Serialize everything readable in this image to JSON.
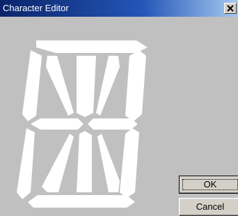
{
  "window": {
    "title": "Character Editor",
    "close_label": "close"
  },
  "display": {
    "segments": [
      "top",
      "upper-left",
      "upper-diagonal-left",
      "upper-center",
      "upper-diagonal-right",
      "upper-right",
      "middle-left",
      "middle-right",
      "lower-left",
      "lower-diagonal-left",
      "lower-center",
      "lower-diagonal-right",
      "lower-right",
      "bottom"
    ],
    "segment_color": "#ffffff"
  },
  "buttons": {
    "ok_label": "OK",
    "cancel_label": "Cancel"
  }
}
